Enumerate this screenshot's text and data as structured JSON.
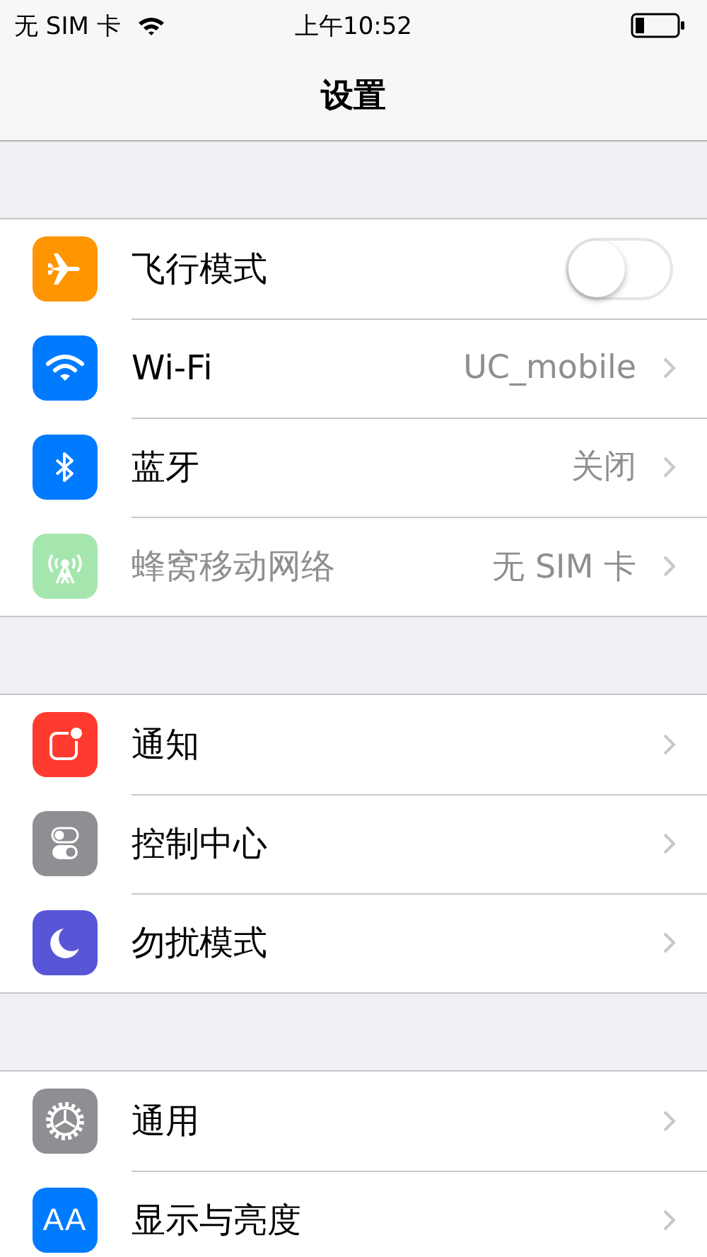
{
  "status_bar": {
    "carrier": "无 SIM 卡",
    "time": "上午10:52"
  },
  "nav_bar": {
    "title": "设置"
  },
  "groups": [
    {
      "rows": [
        {
          "kind": "toggle",
          "color": "#ff9500",
          "label": "飞行模式",
          "on": false,
          "disabled": false
        },
        {
          "kind": "link",
          "color": "#007aff",
          "label": "Wi-Fi",
          "value": "UC_mobile",
          "disabled": false
        },
        {
          "kind": "link",
          "color": "#007aff",
          "label": "蓝牙",
          "value": "关闭",
          "disabled": false
        },
        {
          "kind": "link",
          "color": "#a5e6ae",
          "label": "蜂窝移动网络",
          "value": "无 SIM 卡",
          "disabled": true
        }
      ]
    },
    {
      "rows": [
        {
          "kind": "link",
          "color": "#ff3b30",
          "label": "通知",
          "disabled": false
        },
        {
          "kind": "link",
          "color": "#8e8e93",
          "label": "控制中心",
          "disabled": false
        },
        {
          "kind": "link",
          "color": "#5856d6",
          "label": "勿扰模式",
          "disabled": false
        }
      ]
    },
    {
      "rows": [
        {
          "kind": "link",
          "color": "#8e8e93",
          "label": "通用",
          "disabled": false
        },
        {
          "kind": "link",
          "icon_text": "AA",
          "color": "#007aff",
          "label": "显示与亮度",
          "disabled": false
        }
      ]
    }
  ]
}
